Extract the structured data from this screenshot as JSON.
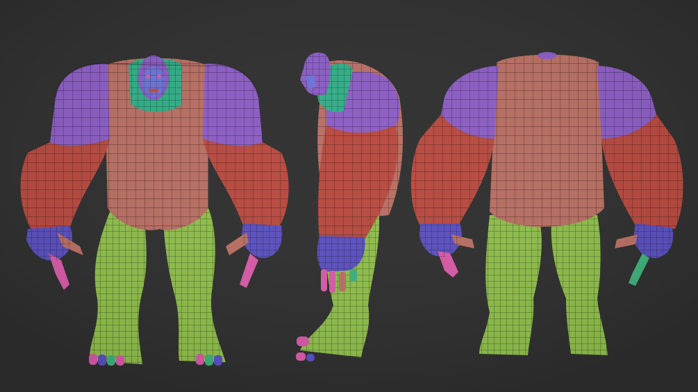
{
  "scene": {
    "background": "#2e2e2e",
    "subject": "creature-model-turnaround",
    "views": [
      "front",
      "side",
      "back"
    ]
  },
  "polygroup_colors": {
    "head": "#8a5cc6",
    "neck_ring": "#2fae86",
    "face": "#6b74d8",
    "shoulders": "#8b5cc4",
    "torso": "#b96e62",
    "arms": "#b8483e",
    "hands": "#5a4fc0",
    "fingers_a": "#d85aa8",
    "fingers_b": "#3fb07a",
    "legs": "#8fbf4a",
    "feet": "#84c248",
    "wire": "#141414"
  }
}
